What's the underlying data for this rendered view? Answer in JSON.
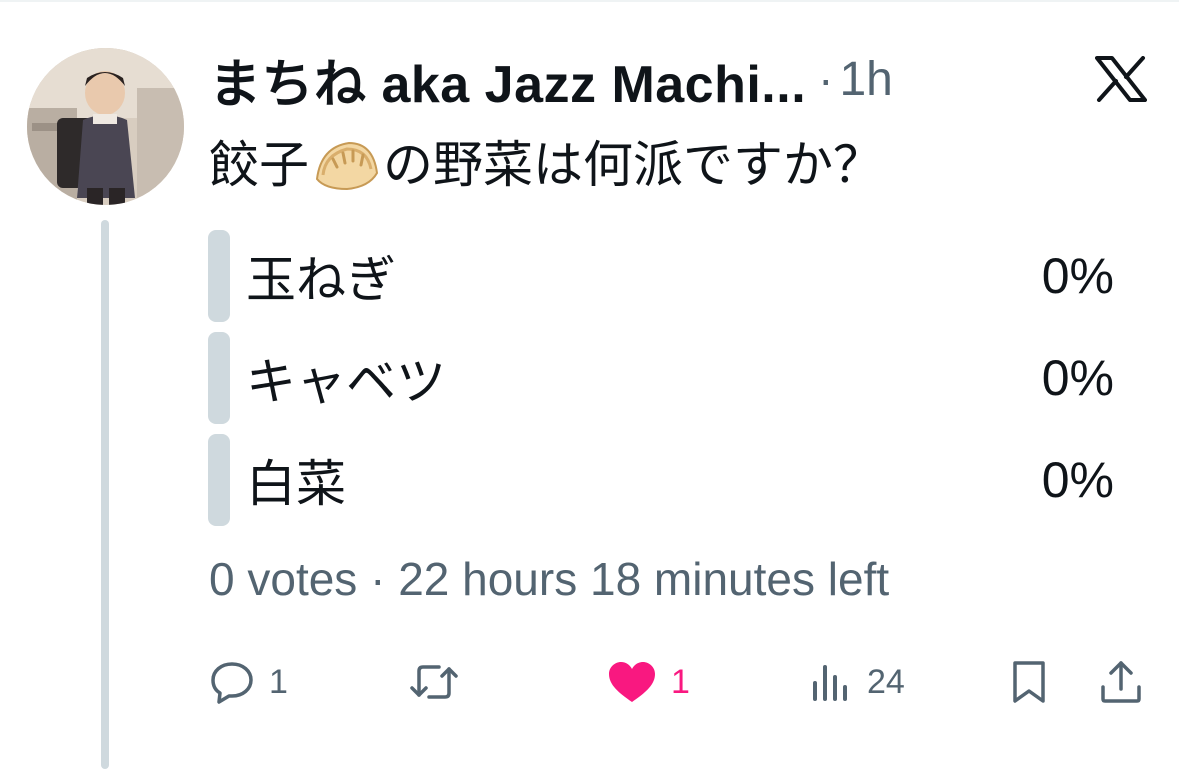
{
  "author": {
    "name": "まちね aka Jazz Machi...",
    "timestamp": "1h",
    "separator": "·"
  },
  "tweet": {
    "text_before_emoji": "餃子",
    "emoji": "dumpling-emoji",
    "text_after_emoji": "の野菜は何派ですか？"
  },
  "poll": {
    "options": [
      {
        "label": "玉ねぎ",
        "percent": "0%",
        "fraction": 0
      },
      {
        "label": "キャベツ",
        "percent": "0%",
        "fraction": 0
      },
      {
        "label": "白菜",
        "percent": "0%",
        "fraction": 0
      }
    ],
    "meta": "0 votes · 22 hours 18 minutes left"
  },
  "actions": {
    "reply_count": "1",
    "retweet_count": "",
    "like_count": "1",
    "views_count": "24"
  },
  "icons": {
    "brand": "x-logo-icon",
    "reply": "reply-icon",
    "retweet": "retweet-icon",
    "like": "heart-icon",
    "views": "views-icon",
    "bookmark": "bookmark-icon",
    "share": "share-icon"
  },
  "colors": {
    "text": "#0f1419",
    "secondary": "#536471",
    "like": "#f91880",
    "poll_bar": "#cfd9de",
    "thread_line": "#cfd9de"
  }
}
